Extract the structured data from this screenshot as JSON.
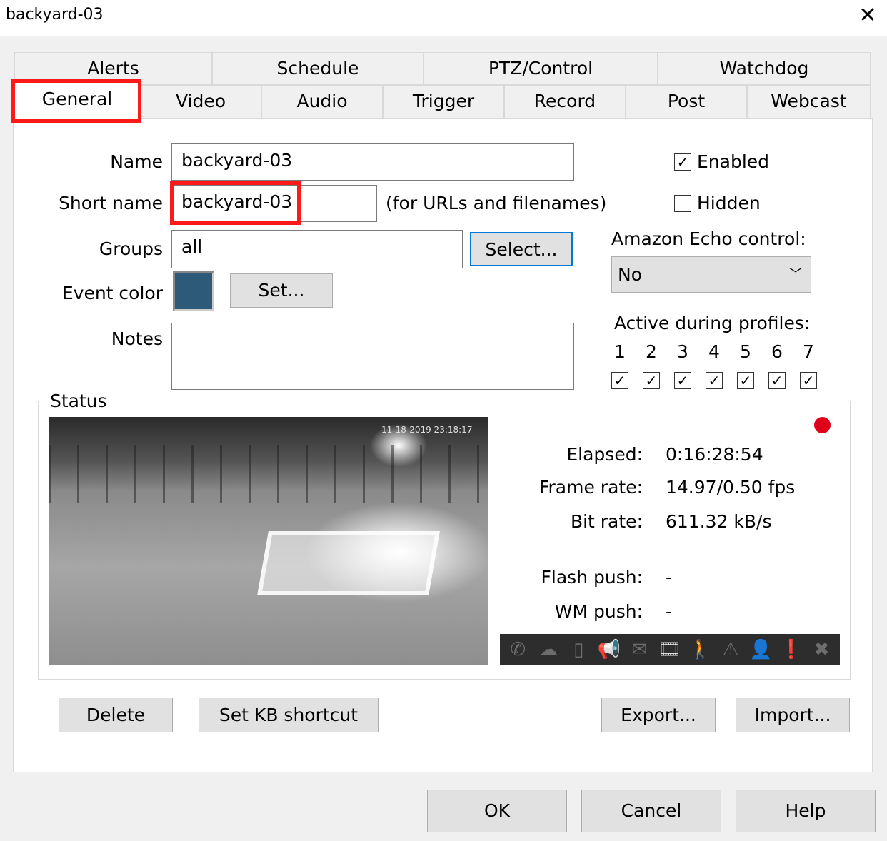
{
  "window": {
    "title": "backyard-03",
    "close_icon": "close-icon"
  },
  "tabs_row1": [
    "Alerts",
    "Schedule",
    "PTZ/Control",
    "Watchdog"
  ],
  "tabs_row2": [
    "General",
    "Video",
    "Audio",
    "Trigger",
    "Record",
    "Post",
    "Webcast"
  ],
  "active_tab": "General",
  "form": {
    "name_label": "Name",
    "name_value": "backyard-03",
    "short_name_label": "Short name",
    "short_name_value": "backyard-03",
    "short_name_hint": "(for URLs and filenames)",
    "groups_label": "Groups",
    "groups_value": "all",
    "select_button": "Select...",
    "event_color_label": "Event color",
    "event_color": "#2e5a7a",
    "set_button": "Set...",
    "notes_label": "Notes",
    "notes_value": "",
    "enabled_label": "Enabled",
    "enabled": true,
    "hidden_label": "Hidden",
    "hidden": false,
    "echo_label": "Amazon Echo control:",
    "echo_value": "No",
    "profiles_label": "Active during profiles:",
    "profiles": [
      {
        "n": "1",
        "on": true
      },
      {
        "n": "2",
        "on": true
      },
      {
        "n": "3",
        "on": true
      },
      {
        "n": "4",
        "on": true
      },
      {
        "n": "5",
        "on": true
      },
      {
        "n": "6",
        "on": true
      },
      {
        "n": "7",
        "on": true
      }
    ]
  },
  "status": {
    "label": "Status",
    "timestamp": "11-18-2019 23:18:17",
    "recording_color": "#e0001a",
    "rows": [
      {
        "label": "Elapsed:",
        "value": "0:16:28:54"
      },
      {
        "label": "Frame rate:",
        "value": "14.97/0.50 fps"
      },
      {
        "label": "Bit rate:",
        "value": "611.32 kB/s"
      },
      {
        "label": "Flash push:",
        "value": "-"
      },
      {
        "label": "WM push:",
        "value": "-"
      }
    ],
    "icons": [
      {
        "name": "phone-icon",
        "glyph": "✆",
        "on": false
      },
      {
        "name": "cloud-upload-icon",
        "glyph": "☁",
        "on": false
      },
      {
        "name": "tablet-icon",
        "glyph": "▯",
        "on": false
      },
      {
        "name": "megaphone-icon",
        "glyph": "📢",
        "on": false
      },
      {
        "name": "email-icon",
        "glyph": "✉",
        "on": false
      },
      {
        "name": "film-icon",
        "glyph": "🎞",
        "on": true
      },
      {
        "name": "motion-icon",
        "glyph": "🚶",
        "on": false
      },
      {
        "name": "warning-icon",
        "glyph": "⚠",
        "on": false
      },
      {
        "name": "person-icon",
        "glyph": "👤",
        "on": false
      },
      {
        "name": "alert-icon",
        "glyph": "❗",
        "on": false
      },
      {
        "name": "cancel-icon",
        "glyph": "✖",
        "on": false
      }
    ]
  },
  "buttons": {
    "delete": "Delete",
    "shortcut": "Set KB shortcut",
    "export": "Export...",
    "import": "Import...",
    "ok": "OK",
    "cancel": "Cancel",
    "help": "Help"
  }
}
